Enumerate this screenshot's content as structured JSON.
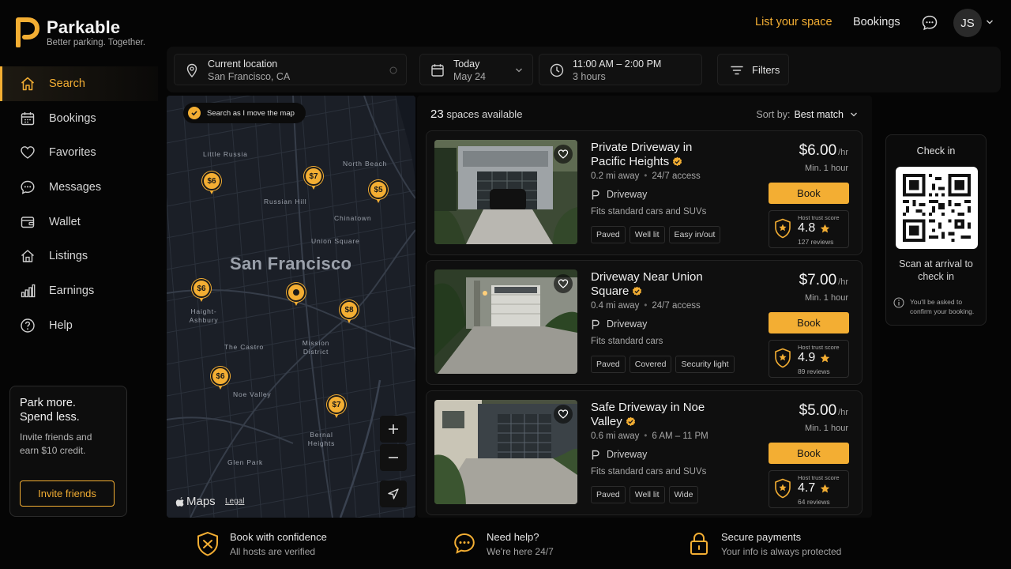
{
  "brand": {
    "name": "Parkable",
    "tagline": "Better parking. Together.",
    "accent": "#f3ae33",
    "logo_icon": "parkable-p-logo"
  },
  "topnav": {
    "list_space": "List your space",
    "bookings": "Bookings",
    "messages_icon": "chat-bubble-icon",
    "avatar_initials": "JS"
  },
  "sidebar": {
    "items": [
      {
        "label": "Search",
        "icon": "home-icon",
        "active": true
      },
      {
        "label": "Bookings",
        "icon": "calendar-icon"
      },
      {
        "label": "Favorites",
        "icon": "heart-icon"
      },
      {
        "label": "Messages",
        "icon": "chat-bubble-icon"
      },
      {
        "label": "Wallet",
        "icon": "wallet-icon"
      },
      {
        "label": "Listings",
        "icon": "house-icon"
      },
      {
        "label": "Earnings",
        "icon": "bar-chart-icon"
      },
      {
        "label": "Help",
        "icon": "question-circle-icon"
      }
    ],
    "promo": {
      "title": "Park more. Spend less.",
      "text": "Invite friends and earn $10 credit.",
      "button": "Invite friends"
    }
  },
  "search": {
    "location_label": "Current location",
    "location_value": "San Francisco, CA",
    "date_label": "Today",
    "date_value": "May 24",
    "time_label": "11:00 AM – 2:00 PM",
    "time_value": "3 hours",
    "filters": "Filters"
  },
  "map": {
    "toggle_label": "Search as I move the map",
    "city": "San Francisco",
    "neighborhoods": [
      "Little Russia",
      "North Beach",
      "Russian Hill",
      "Chinatown",
      "Union Square",
      "Haight-Ashbury",
      "The Castro",
      "Mission District",
      "Noe Valley",
      "Bernal Heights",
      "Glen Park"
    ],
    "pins": [
      "$6",
      "$7",
      "$5",
      "$6",
      "$8",
      "$6",
      "$7"
    ],
    "brand": "Maps",
    "legal": "Legal"
  },
  "results": {
    "count": "23",
    "count_label": "spaces available",
    "sort_label": "Sort by:",
    "sort_value": "Best match",
    "listings": [
      {
        "title": "Private Driveway in Pacific Heights",
        "distance": "0.2 mi away",
        "access": "24/7 access",
        "type": "Driveway",
        "fits": "Fits standard cars and SUVs",
        "tags": [
          "Paved",
          "Well lit",
          "Easy in/out"
        ],
        "price": "$6.00",
        "unit": "/hr",
        "min": "Min. 1 hour",
        "book": "Book",
        "trust_label": "Host trust score",
        "score": "4.8",
        "reviews": "127 reviews"
      },
      {
        "title": "Driveway Near Union Square",
        "distance": "0.4 mi away",
        "access": "24/7 access",
        "type": "Driveway",
        "fits": "Fits standard cars",
        "tags": [
          "Paved",
          "Covered",
          "Security light"
        ],
        "price": "$7.00",
        "unit": "/hr",
        "min": "Min. 1 hour",
        "book": "Book",
        "trust_label": "Host trust score",
        "score": "4.9",
        "reviews": "89 reviews"
      },
      {
        "title": "Safe Driveway in Noe Valley",
        "distance": "0.6 mi away",
        "access": "6 AM – 11 PM",
        "type": "Driveway",
        "fits": "Fits standard cars and SUVs",
        "tags": [
          "Paved",
          "Well lit",
          "Wide"
        ],
        "price": "$5.00",
        "unit": "/hr",
        "min": "Min. 1 hour",
        "book": "Book",
        "trust_label": "Host trust score",
        "score": "4.7",
        "reviews": "64 reviews"
      }
    ]
  },
  "checkin": {
    "title": "Check in",
    "scan_text": "Scan at arrival to check in",
    "note": "You'll be asked to confirm your booking."
  },
  "footer": [
    {
      "title": "Book with confidence",
      "sub": "All hosts are verified",
      "icon": "shield-check-icon"
    },
    {
      "title": "Need help?",
      "sub": "We're here 24/7",
      "icon": "chat-bubble-icon"
    },
    {
      "title": "Secure payments",
      "sub": "Your info is always protected",
      "icon": "lock-icon"
    }
  ]
}
